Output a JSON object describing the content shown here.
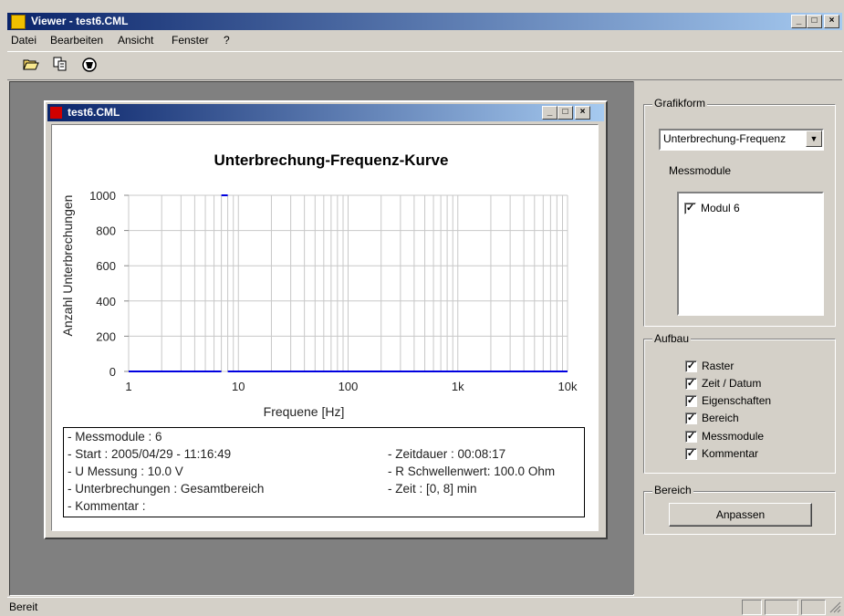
{
  "window": {
    "title": "Viewer - test6.CML",
    "buttons": {
      "min": "_",
      "max": "□",
      "close": "×"
    }
  },
  "menu": [
    "Datei",
    "Bearbeiten",
    "Ansicht",
    "Fenster",
    "?"
  ],
  "toolbar": {
    "icons": [
      "open-folder-icon",
      "copy-icon",
      "print-icon"
    ]
  },
  "child": {
    "title": "test6.CML",
    "buttons": {
      "min": "_",
      "max": "□",
      "close": "×"
    }
  },
  "info": {
    "messmodule": "- Messmodule : 6",
    "start": "- Start : 2005/04/29 - 11:16:49",
    "u_messung": "- U Messung : 10.0 V",
    "unterbrechungen": "- Unterbrechungen : Gesamtbereich",
    "kommentar": "- Kommentar :",
    "zeitdauer": "- Zeitdauer : 00:08:17",
    "schwellenwert": "- R Schwellenwert: 100.0 Ohm",
    "zeit": "- Zeit : [0, 8] min"
  },
  "panel": {
    "grafikform_label": "Grafikform",
    "grafikform_value": "Unterbrechung-Frequenz",
    "messmodule_label": "Messmodule",
    "modules": [
      {
        "label": "Modul 6",
        "checked": true
      }
    ],
    "aufbau_label": "Aufbau",
    "aufbau_items": [
      {
        "label": "Raster",
        "checked": true
      },
      {
        "label": "Zeit / Datum",
        "checked": true
      },
      {
        "label": "Eigenschaften",
        "checked": true
      },
      {
        "label": "Bereich",
        "checked": true
      },
      {
        "label": "Messmodule",
        "checked": true
      },
      {
        "label": "Kommentar",
        "checked": true
      }
    ],
    "bereich_label": "Bereich",
    "anpassen_label": "Anpassen"
  },
  "status": {
    "text": "Bereit"
  },
  "colors": {
    "title_start": "#0a246a",
    "title_end": "#a6caf0",
    "series": "#0000e0",
    "grid": "#c8c8c8"
  },
  "chart_data": {
    "type": "line",
    "title": "Unterbrechung-Frequenz-Kurve",
    "xlabel": "Frequene [Hz]",
    "ylabel": "Anzahl Unterbrechungen",
    "x_scale": "log",
    "xlim": [
      1,
      10000
    ],
    "ylim": [
      0,
      1000
    ],
    "x_ticks": [
      {
        "value": 1,
        "label": "1"
      },
      {
        "value": 10,
        "label": "10"
      },
      {
        "value": 100,
        "label": "100"
      },
      {
        "value": 1000,
        "label": "1k"
      },
      {
        "value": 10000,
        "label": "10k"
      }
    ],
    "y_ticks": [
      0,
      200,
      400,
      600,
      800,
      1000
    ],
    "grid": true,
    "series": [
      {
        "points": [
          [
            1,
            0
          ],
          [
            7,
            0
          ],
          [
            7,
            1000
          ],
          [
            8,
            1000
          ],
          [
            8,
            0
          ],
          [
            10000,
            0
          ]
        ]
      }
    ]
  }
}
